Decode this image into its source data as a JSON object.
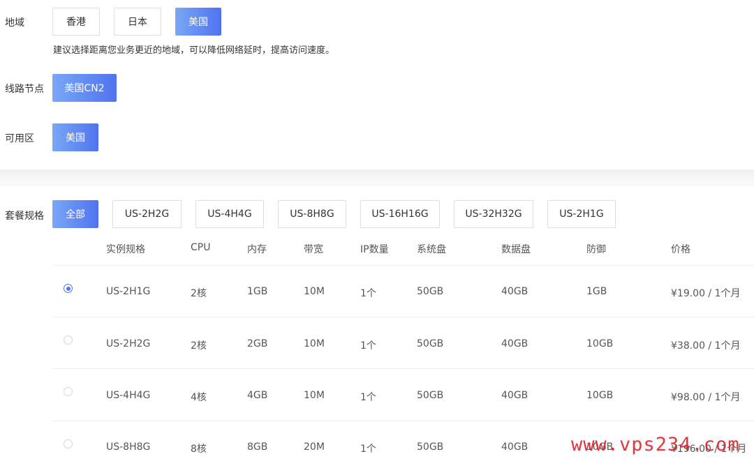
{
  "region": {
    "label": "地域",
    "options": [
      "香港",
      "日本",
      "美国"
    ],
    "selected": "美国",
    "hint": "建议选择距离您业务更近的地域，可以降低网络延时，提高访问速度。"
  },
  "route": {
    "label": "线路节点",
    "options": [
      "美国CN2"
    ],
    "selected": "美国CN2"
  },
  "zone": {
    "label": "可用区",
    "options": [
      "美国"
    ],
    "selected": "美国"
  },
  "plans": {
    "label": "套餐规格",
    "filters": [
      "全部",
      "US-2H2G",
      "US-4H4G",
      "US-8H8G",
      "US-16H16G",
      "US-32H32G",
      "US-2H1G"
    ],
    "selected_filter": "全部",
    "columns": [
      "实例规格",
      "CPU",
      "内存",
      "带宽",
      "IP数量",
      "系统盘",
      "数据盘",
      "防御",
      "价格"
    ],
    "rows": [
      {
        "checked": true,
        "cells": [
          "US-2H1G",
          "2核",
          "1GB",
          "10M",
          "1个",
          "50GB",
          "40GB",
          "1GB",
          "¥19.00 / 1个月"
        ]
      },
      {
        "checked": false,
        "cells": [
          "US-2H2G",
          "2核",
          "2GB",
          "10M",
          "1个",
          "50GB",
          "40GB",
          "10GB",
          "¥38.00 / 1个月"
        ]
      },
      {
        "checked": false,
        "cells": [
          "US-4H4G",
          "4核",
          "4GB",
          "10M",
          "1个",
          "50GB",
          "40GB",
          "10GB",
          "¥98.00 / 1个月"
        ]
      },
      {
        "checked": false,
        "cells": [
          "US-8H8G",
          "8核",
          "8GB",
          "20M",
          "1个",
          "50GB",
          "40GB",
          "10GB",
          "¥196.00 / 1个月"
        ]
      }
    ]
  },
  "watermark": {
    "text": "www.vps234.com"
  },
  "colors": {
    "accent_start": "#7aa7f7",
    "accent_end": "#4f73ef",
    "watermark": "#e0252d"
  }
}
